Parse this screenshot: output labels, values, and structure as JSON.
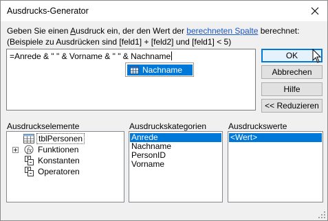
{
  "window": {
    "title": "Ausdrucks-Generator",
    "close_glyph": "✕"
  },
  "description": {
    "line1_pre": "Geben Sie einen ",
    "line1_u": "A",
    "line1_mid": "usdruck ein, der den Wert der ",
    "line1_link": "berechneten Spalte",
    "line1_post": " berechnet:",
    "line2": "(Beispiele zu Ausdrücken sind [feld1] + [feld2] und [feld1] < 5)"
  },
  "expression": {
    "value": "=Anrede & \" \" & Vorname & \" \" & Nachname"
  },
  "autocomplete": {
    "item": "Nachname",
    "icon": "table-icon"
  },
  "buttons": {
    "ok": "OK",
    "cancel": "Abbrechen",
    "help": "Hilfe",
    "reduce": "<< Reduzieren"
  },
  "sections": {
    "elements": "Ausdruckselemente",
    "categories": "Ausdruckskategorien",
    "values": "Ausdruckswerte"
  },
  "elements_tree": [
    {
      "label": "tblPersonen",
      "icon": "table-icon",
      "selected": true,
      "expander": false
    },
    {
      "label": "Funktionen",
      "icon": "function-icon",
      "selected": false,
      "expander": true
    },
    {
      "label": "Konstanten",
      "icon": "constants-icon",
      "selected": false,
      "expander": false
    },
    {
      "label": "Operatoren",
      "icon": "operators-icon",
      "selected": false,
      "expander": false
    }
  ],
  "categories_list": [
    "Anrede",
    "Nachname",
    "PersonID",
    "Vorname"
  ],
  "categories_selected": "Anrede",
  "values_list": [
    "<Wert>"
  ],
  "values_selected": "<Wert>",
  "colors": {
    "accent": "#0078d7",
    "link": "#1a56c4"
  }
}
